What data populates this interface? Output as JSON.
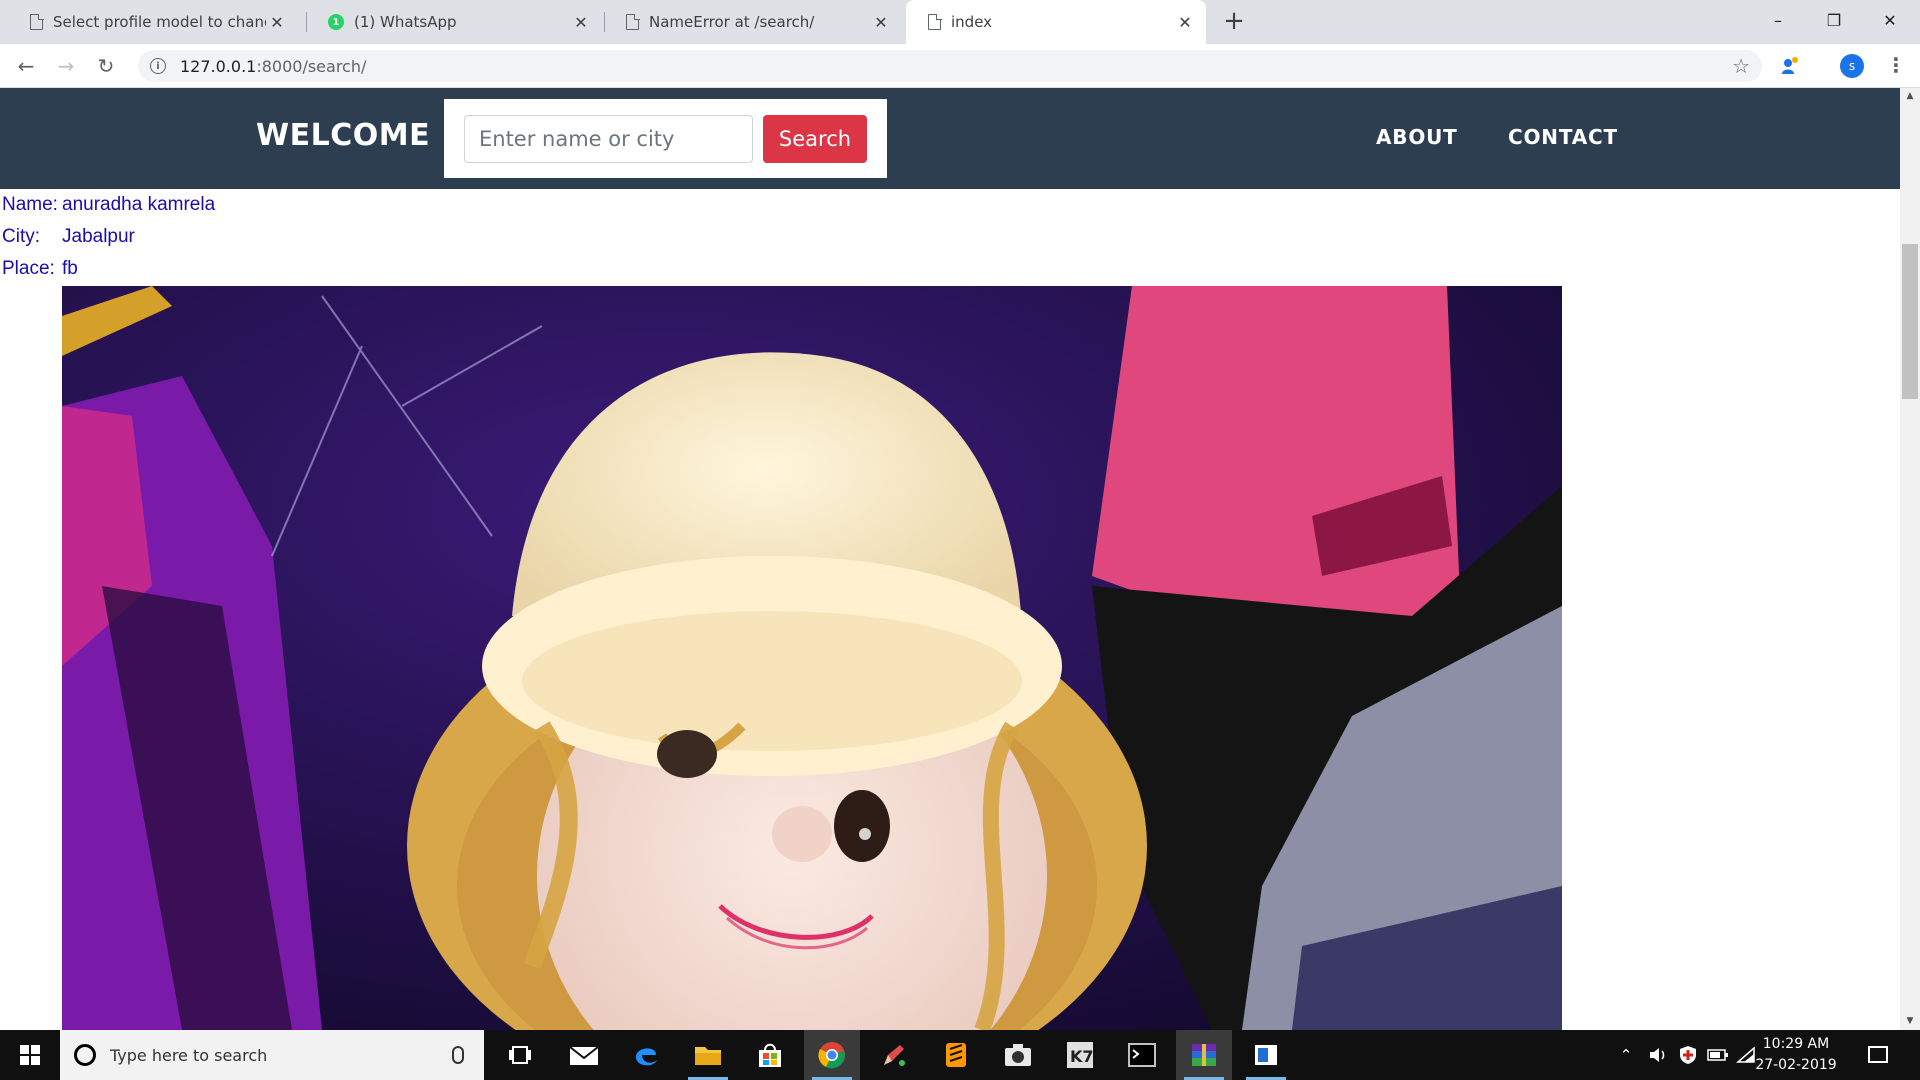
{
  "browser": {
    "tabs": [
      {
        "title": "Select profile model to change | D",
        "favicon": "document-icon",
        "active": false
      },
      {
        "title": "(1) WhatsApp",
        "favicon": "whatsapp-icon",
        "badge": "1",
        "active": false
      },
      {
        "title": "NameError at /search/",
        "favicon": "document-icon",
        "active": false
      },
      {
        "title": "index",
        "favicon": "document-icon",
        "active": true
      }
    ],
    "new_tab_symbol": "+",
    "url_host": "127.0.0.1",
    "url_path": ":8000/search/",
    "profile_initial": "s",
    "window_controls": {
      "minimize": "–",
      "restore": "❐",
      "close": "✕"
    },
    "nav_symbols": {
      "back": "←",
      "forward": "→",
      "reload": "↻",
      "info": "i",
      "star": "☆",
      "menu": "⋮"
    }
  },
  "site": {
    "brand": "WELCOME",
    "search_placeholder": "Enter name or city",
    "search_value": "",
    "search_button": "Search",
    "nav_links": [
      "ABOUT",
      "CONTACT"
    ],
    "accent_color": "#dc3545",
    "nav_bg": "#2c3e50"
  },
  "profile": {
    "name_label": "Name:",
    "name_value": "anuradha kamrela",
    "city_label": "City:",
    "city_value": "Jabalpur",
    "place_label": "Place:",
    "place_value": "fb",
    "photo": "Photo of a doll with cream fur hat and curly blonde hair"
  },
  "taskbar": {
    "search_placeholder": "Type here to search",
    "apps": [
      "task-view-icon",
      "mail-icon",
      "edge-icon",
      "file-explorer-icon",
      "store-icon",
      "chrome-icon",
      "pencil-app-icon",
      "sublime-icon",
      "camera-app-icon",
      "k7-icon",
      "terminal-icon",
      "winrar-icon",
      "notepad-icon"
    ],
    "time": "10:29 AM",
    "date": "27-02-2019"
  }
}
